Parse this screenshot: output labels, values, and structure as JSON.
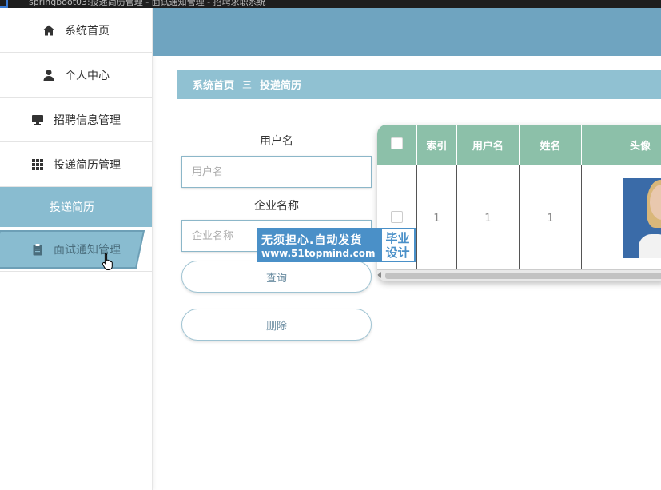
{
  "window": {
    "title": "springboot03:投递简历管理 - 面试通知管理 - 招聘求职系统"
  },
  "sidebar": {
    "items": [
      {
        "label": "系统首页",
        "icon": "home-icon"
      },
      {
        "label": "个人中心",
        "icon": "user-icon"
      },
      {
        "label": "招聘信息管理",
        "icon": "monitor-icon"
      },
      {
        "label": "投递简历管理",
        "icon": "grid-icon"
      },
      {
        "label": "投递简历",
        "icon": ""
      },
      {
        "label": "面试通知管理",
        "icon": "clipboard-icon"
      }
    ]
  },
  "breadcrumb": {
    "home": "系统首页",
    "separator": "三",
    "current": "投递简历"
  },
  "search": {
    "username_label": "用户名",
    "username_placeholder": "用户名",
    "company_label": "企业名称",
    "company_placeholder": "企业名称",
    "query_button": "查询",
    "delete_button": "删除"
  },
  "watermark": {
    "line1": "无须担心.自动发货",
    "line2": "www.51topmind.com",
    "badge1": "毕业",
    "badge2": "设计"
  },
  "table": {
    "columns": [
      "",
      "索引",
      "用户名",
      "姓名",
      "头像"
    ],
    "rows": [
      {
        "index": "1",
        "username": "1",
        "name": "1"
      }
    ]
  },
  "colors": {
    "header": "#6fa4c0",
    "breadcrumb": "#90c1d2",
    "table_header": "#8cc0a9",
    "active_menu": "#89bcd0"
  }
}
